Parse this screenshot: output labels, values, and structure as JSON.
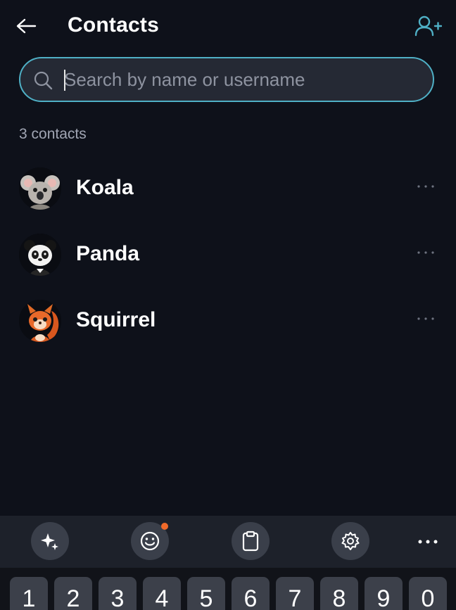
{
  "header": {
    "title": "Contacts",
    "back_icon": "arrow-left-icon",
    "add_icon": "add-contact-icon"
  },
  "search": {
    "placeholder": "Search by name or username",
    "value": "",
    "icon": "search-icon"
  },
  "contacts_count": "3 contacts",
  "contacts": [
    {
      "name": "Koala",
      "avatar": "koala-avatar"
    },
    {
      "name": "Panda",
      "avatar": "panda-avatar"
    },
    {
      "name": "Squirrel",
      "avatar": "squirrel-avatar"
    }
  ],
  "keyboard": {
    "toolbar": [
      "sparkles-icon",
      "emoji-icon",
      "clipboard-icon",
      "settings-icon",
      "more-icon"
    ],
    "number_keys": [
      "1",
      "2",
      "3",
      "4",
      "5",
      "6",
      "7",
      "8",
      "9",
      "0"
    ]
  },
  "colors": {
    "background": "#0e111a",
    "accent": "#4fb0c6",
    "notification_dot": "#f06a2a"
  }
}
